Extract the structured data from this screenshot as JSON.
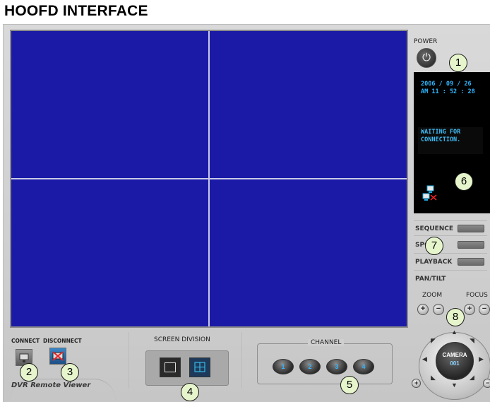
{
  "doc_title": "HOOFD INTERFACE",
  "power": {
    "label": "POWER",
    "icon": "power-icon"
  },
  "status": {
    "date": "2006 / 09 / 26",
    "time": "AM 11 : 52 : 28",
    "message_line1": "WAITING FOR",
    "message_line2": "CONNECTION."
  },
  "side_controls": {
    "sequence": "SEQUENCE",
    "spot": "SPOT",
    "playback": "PLAYBACK",
    "pan_tilt": "PAN/TILT",
    "zoom": "ZOOM",
    "focus": "FOCUS",
    "plus": "+",
    "minus": "−"
  },
  "camera": {
    "label": "CAMERA",
    "number": "001"
  },
  "bottom": {
    "connect": "CONNECT",
    "disconnect": "DISCONNECT",
    "app_name": "DVR Remote Viewer",
    "screen_division": "SCREEN DIVISION",
    "channel": "CHANNEL",
    "channels": [
      "1",
      "2",
      "3",
      "4"
    ]
  },
  "callouts": [
    "1",
    "2",
    "3",
    "4",
    "5",
    "6",
    "7",
    "8"
  ],
  "colors": {
    "video_bg": "#1a1aa6",
    "status_text": "#2fb6ff",
    "callout_bg": "#e6f5cc"
  }
}
